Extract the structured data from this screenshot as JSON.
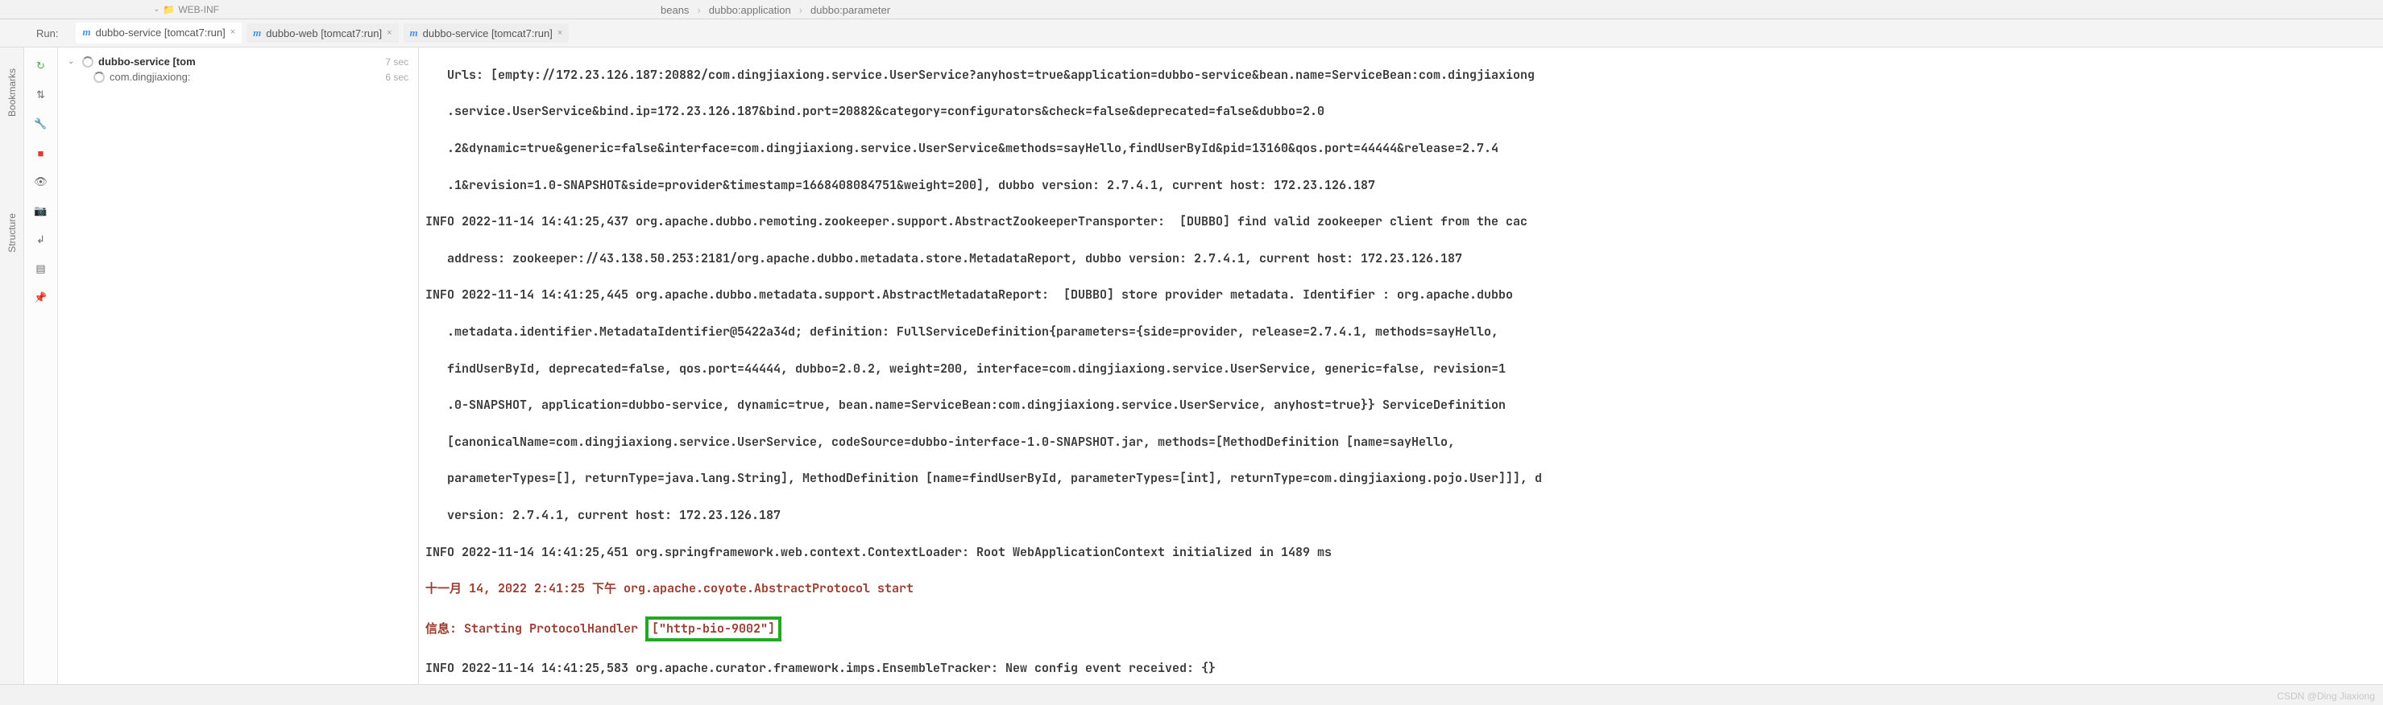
{
  "project_tree": {
    "expander": "⌄",
    "folder_name": "WEB-INF"
  },
  "breadcrumb": {
    "items": [
      "beans",
      "dubbo:application",
      "dubbo:parameter"
    ]
  },
  "run": {
    "label": "Run:",
    "tabs": [
      {
        "icon": "m",
        "label": "dubbo-service [tomcat7:run]"
      },
      {
        "icon": "m",
        "label": "dubbo-web [tomcat7:run]"
      },
      {
        "icon": "m",
        "label": "dubbo-service [tomcat7:run]"
      }
    ]
  },
  "gutter": {
    "rerun": "↻",
    "toggle": "⇅",
    "wrench": "🔧",
    "stop": "■",
    "view": "👁",
    "camera": "📷",
    "export": "↲",
    "layout": "▤",
    "pin": "📌"
  },
  "side_tabs": {
    "bookmarks": "Bookmarks",
    "structure": "Structure"
  },
  "tree": {
    "root": {
      "name": "dubbo-service [tom",
      "time": "7 sec"
    },
    "child": {
      "name": "com.dingjiaxiong:",
      "time": "6 sec"
    }
  },
  "console": {
    "l1": "   Urls: [empty://172.23.126.187:20882/com.dingjiaxiong.service.UserService?anyhost=true&application=dubbo-service&bean.name=ServiceBean:com.dingjiaxiong",
    "l2": "   .service.UserService&bind.ip=172.23.126.187&bind.port=20882&category=configurators&check=false&deprecated=false&dubbo=2.0",
    "l3": "   .2&dynamic=true&generic=false&interface=com.dingjiaxiong.service.UserService&methods=sayHello,findUserById&pid=13160&qos.port=44444&release=2.7.4",
    "l4": "   .1&revision=1.0-SNAPSHOT&side=provider&timestamp=1668408084751&weight=200], dubbo version: 2.7.4.1, current host: 172.23.126.187",
    "l5": "INFO 2022-11-14 14:41:25,437 org.apache.dubbo.remoting.zookeeper.support.AbstractZookeeperTransporter:  [DUBBO] find valid zookeeper client from the cac",
    "l6": "   address: zookeeper://43.138.50.253:2181/org.apache.dubbo.metadata.store.MetadataReport, dubbo version: 2.7.4.1, current host: 172.23.126.187",
    "l7": "INFO 2022-11-14 14:41:25,445 org.apache.dubbo.metadata.support.AbstractMetadataReport:  [DUBBO] store provider metadata. Identifier : org.apache.dubbo",
    "l8": "   .metadata.identifier.MetadataIdentifier@5422a34d; definition: FullServiceDefinition{parameters={side=provider, release=2.7.4.1, methods=sayHello,",
    "l9": "   findUserById, deprecated=false, qos.port=44444, dubbo=2.0.2, weight=200, interface=com.dingjiaxiong.service.UserService, generic=false, revision=1",
    "l10": "   .0-SNAPSHOT, application=dubbo-service, dynamic=true, bean.name=ServiceBean:com.dingjiaxiong.service.UserService, anyhost=true}} ServiceDefinition",
    "l11": "   [canonicalName=com.dingjiaxiong.service.UserService, codeSource=dubbo-interface-1.0-SNAPSHOT.jar, methods=[MethodDefinition [name=sayHello,",
    "l12": "   parameterTypes=[], returnType=java.lang.String], MethodDefinition [name=findUserById, parameterTypes=[int], returnType=com.dingjiaxiong.pojo.User]]], d",
    "l13": "   version: 2.7.4.1, current host: 172.23.126.187",
    "l14": "INFO 2022-11-14 14:41:25,451 org.springframework.web.context.ContextLoader: Root WebApplicationContext initialized in 1489 ms",
    "l15a": "十一月 14, 2022 2:41:25 下午 org.apache.coyote.AbstractProtocol start",
    "l16a": "信息: Starting ProtocolHandler ",
    "l16b": "[\"http-bio-9002\"]",
    "l17": "INFO 2022-11-14 14:41:25,583 org.apache.curator.framework.imps.EnsembleTracker: New config event received: {}"
  },
  "watermark": "CSDN @Ding Jiaxiong"
}
